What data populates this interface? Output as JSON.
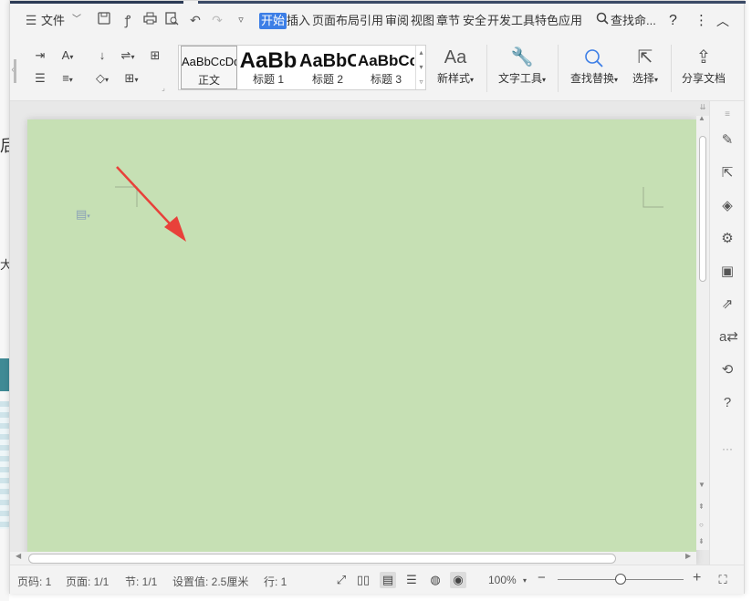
{
  "topbar": {
    "file_menu": "文件",
    "tabs": [
      "开始",
      "插入",
      "页面布局",
      "引用",
      "审阅",
      "视图",
      "章节",
      "安全",
      "开发工具",
      "特色应用"
    ],
    "search": "查找命...",
    "help": "?",
    "more": "⋮",
    "collapse": "︿"
  },
  "ribbon": {
    "styles": [
      {
        "sample": "AaBbCcDd",
        "name": "正文"
      },
      {
        "sample": "AaBb",
        "name": "标题 1"
      },
      {
        "sample": "AaBbC",
        "name": "标题 2"
      },
      {
        "sample": "AaBbCc",
        "name": "标题 3"
      }
    ],
    "new_style": "新样式",
    "text_tools": "文字工具",
    "find_replace": "查找替换",
    "select": "选择",
    "share": "分享文档"
  },
  "document": {
    "background_color": "#c6e0b4"
  },
  "statusbar": {
    "page_num": "页码: 1",
    "pages": "页面: 1/1",
    "section": "节: 1/1",
    "setting": "设置值: 2.5厘米",
    "line": "行: 1",
    "zoom": "100%",
    "zoom_minus": "−",
    "zoom_plus": "+",
    "zoom_level": 0.5
  },
  "background_window": {
    "char1": "后",
    "char2": "大"
  },
  "colors": {
    "accent": "#3c7ee6",
    "arrow": "#e8413a"
  }
}
